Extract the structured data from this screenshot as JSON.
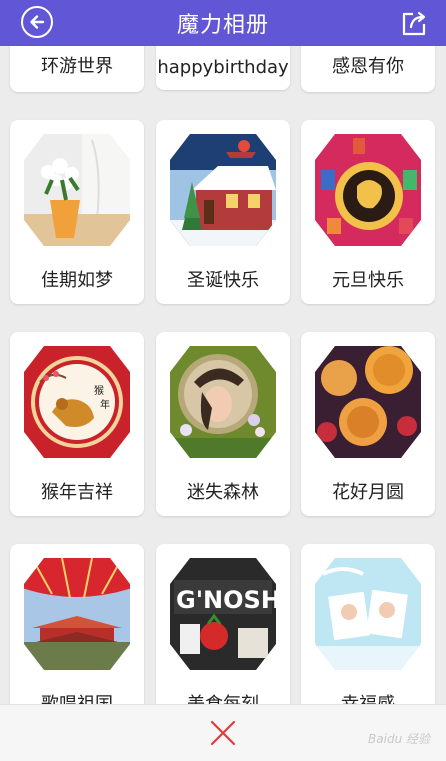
{
  "header": {
    "title": "魔力相册",
    "back_icon": "back-arrow-circle-icon",
    "share_icon": "share-icon",
    "bg_color": "#6157d6"
  },
  "albums": [
    {
      "label": "环游世界",
      "icon": "partial-card"
    },
    {
      "label": "happybirthday",
      "icon": "partial-card"
    },
    {
      "label": "感恩有你",
      "icon": "partial-card"
    },
    {
      "label": "佳期如梦",
      "icon": "flowers-vase-thumbnail"
    },
    {
      "label": "圣诞快乐",
      "icon": "christmas-house-thumbnail"
    },
    {
      "label": "元旦快乐",
      "icon": "new-year-lantern-thumbnail"
    },
    {
      "label": "猴年吉祥",
      "icon": "monkey-year-thumbnail"
    },
    {
      "label": "迷失森林",
      "icon": "forest-portrait-thumbnail"
    },
    {
      "label": "花好月圆",
      "icon": "mooncake-thumbnail"
    },
    {
      "label": "歌唱祖国",
      "icon": "forbidden-city-thumbnail"
    },
    {
      "label": "美食每刻",
      "icon": "gnosh-food-thumbnail"
    },
    {
      "label": "幸福感",
      "icon": "happy-kids-thumbnail"
    }
  ],
  "bottom": {
    "close_icon": "close-x-icon",
    "close_color": "#e03c3c"
  },
  "watermark": "Baidu 经验"
}
